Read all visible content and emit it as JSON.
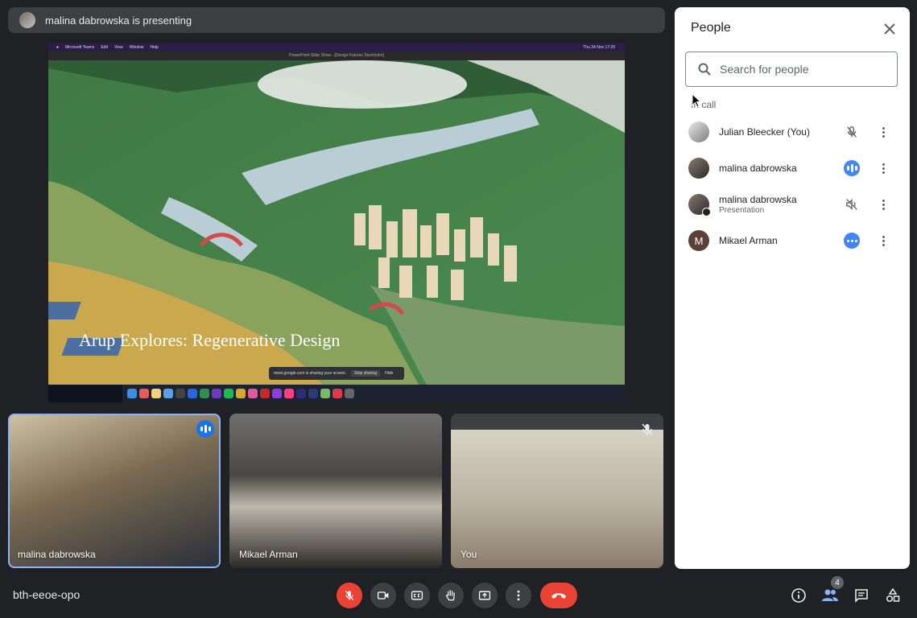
{
  "banner": {
    "text": "malina dabrowska is presenting"
  },
  "presentation": {
    "title": "Arup Explores: Regenerative Design",
    "mac_menu": [
      "Microsoft Teams",
      "Edit",
      "View",
      "Window",
      "Help"
    ],
    "mac_clock": "Thu 24 Nov  17:26",
    "window_title": "PowerPoint Slide Show - [Design Futures Stockholm]",
    "share_notice": "meet.google.com is sharing your screen.",
    "stop_sharing": "Stop sharing",
    "hide": "Hide"
  },
  "tiles": [
    {
      "name": "malina dabrowska",
      "speaking": true
    },
    {
      "name": "Mikael Arman"
    },
    {
      "name": "You",
      "muted": true
    }
  ],
  "people_panel": {
    "title": "People",
    "search_placeholder": "Search for people",
    "section_label": "In call",
    "people": [
      {
        "name": "Julian Bleecker (You)",
        "subtitle": "",
        "status": "mic-off"
      },
      {
        "name": "malina dabrowska",
        "subtitle": "",
        "status": "speaking"
      },
      {
        "name": "malina dabrowska",
        "subtitle": "Presentation",
        "status": "audio-off"
      },
      {
        "name": "Mikael Arman",
        "subtitle": "",
        "status": "more",
        "initial": "M"
      }
    ]
  },
  "footer": {
    "meeting_code": "bth-eeoe-opo",
    "participant_count": "4"
  },
  "colors": {
    "accent": "#1a73e8",
    "danger": "#ea4335",
    "background": "#202124"
  }
}
